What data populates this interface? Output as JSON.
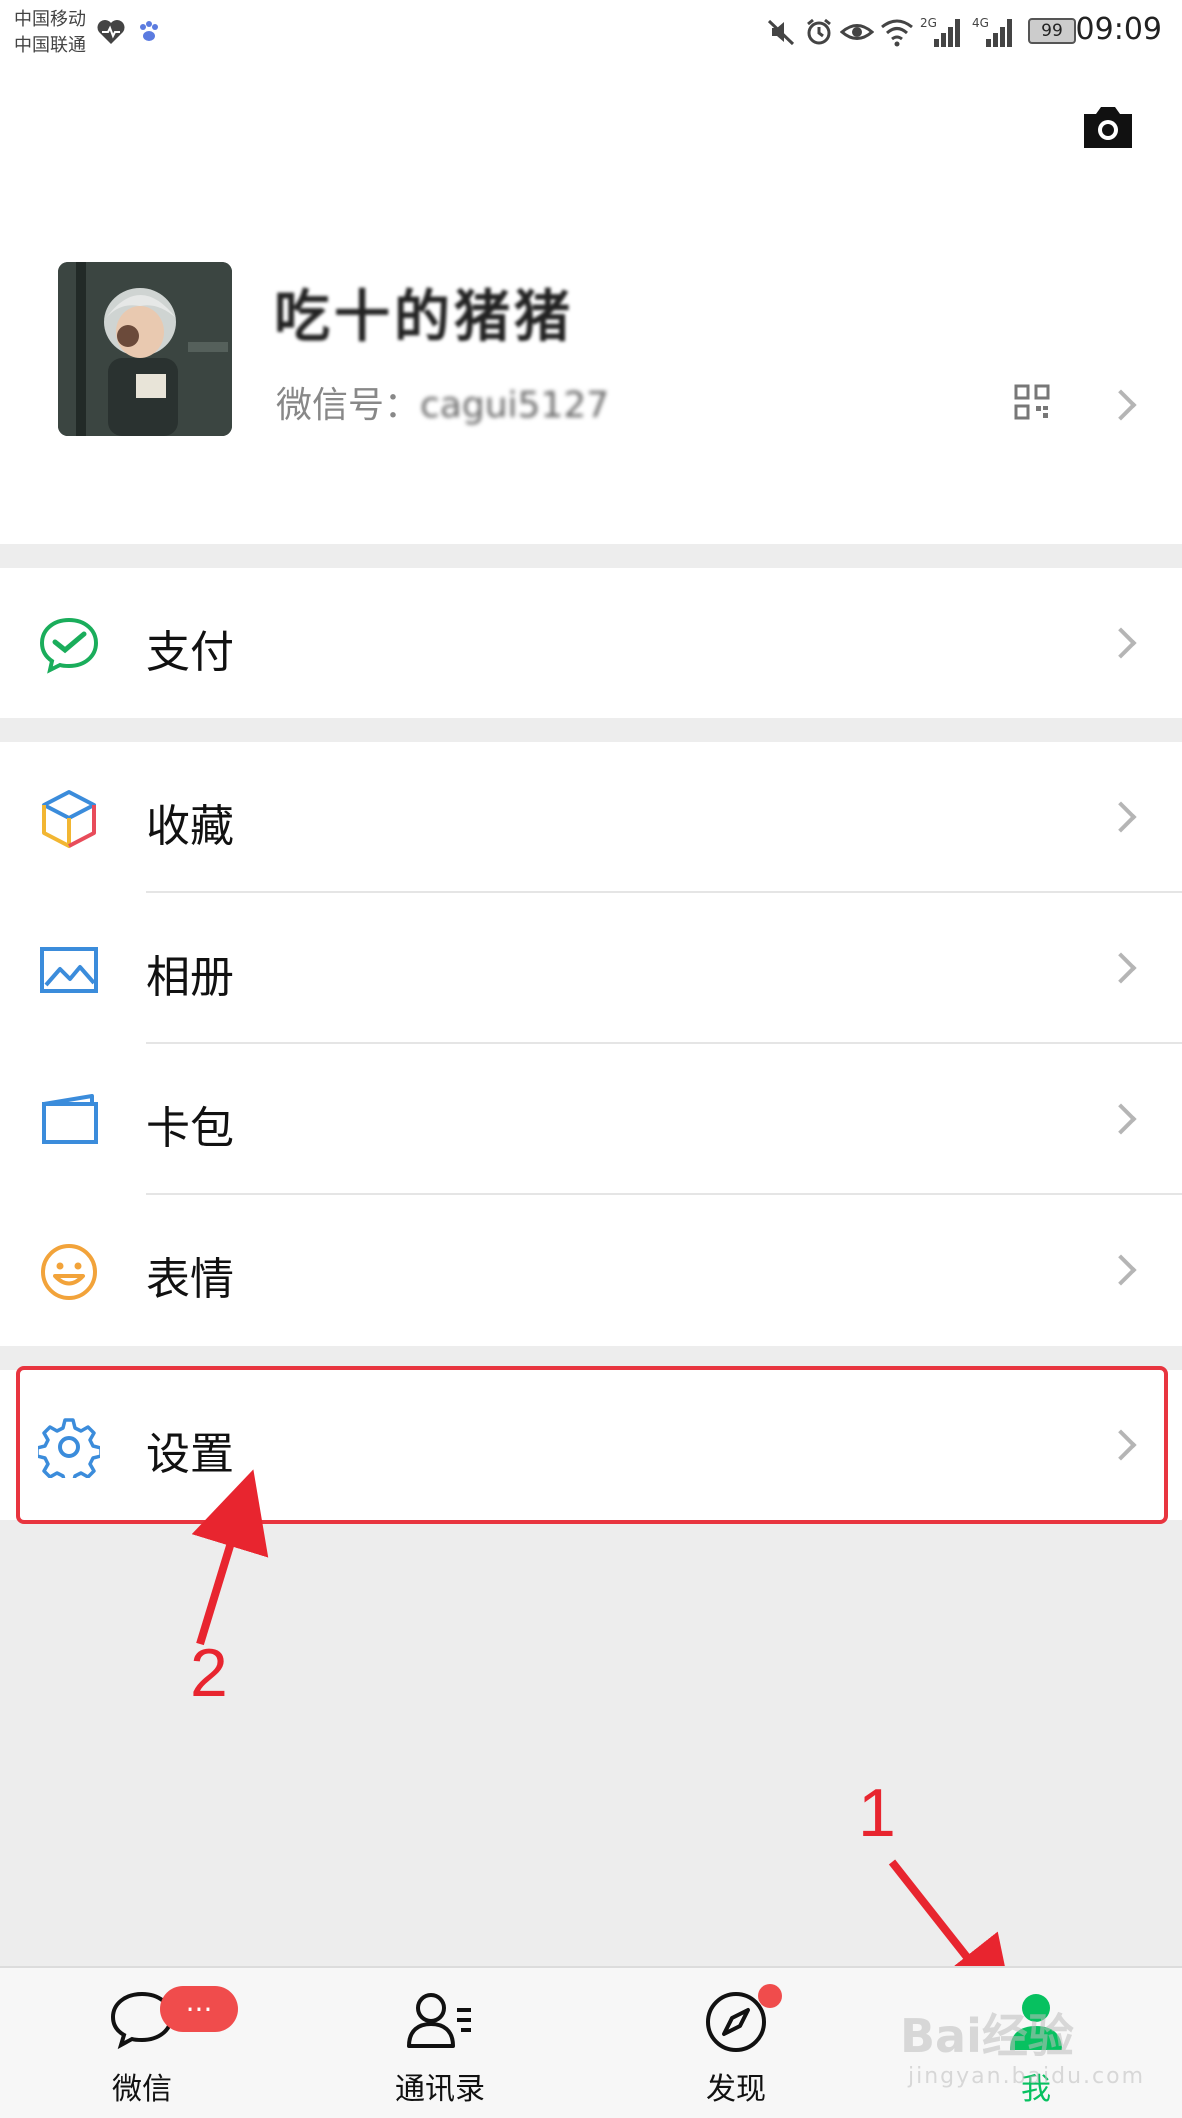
{
  "status_bar": {
    "carrier_1": "中国移动",
    "carrier_2": "中国联通",
    "network_2g": "2G",
    "network_4g": "4G",
    "battery": "99",
    "time": "09:09"
  },
  "profile": {
    "nickname": "吃十的猪猪",
    "wechat_id_label": "微信号：",
    "wechat_id_value": "cagui5127"
  },
  "menu": {
    "pay": "支付",
    "favorites": "收藏",
    "album": "相册",
    "cards": "卡包",
    "stickers": "表情",
    "settings": "设置"
  },
  "annotations": {
    "step_1": "1",
    "step_2": "2"
  },
  "tabbar": {
    "chats": "微信",
    "chats_badge": "···",
    "contacts": "通讯录",
    "discover": "发现",
    "me": "我"
  },
  "watermark": {
    "text": "Bai经验",
    "sub": "jingyan.baidu.com"
  },
  "colors": {
    "accent_green": "#07c160",
    "annotation_red": "#e8353f",
    "badge_red": "#f04c4c"
  }
}
